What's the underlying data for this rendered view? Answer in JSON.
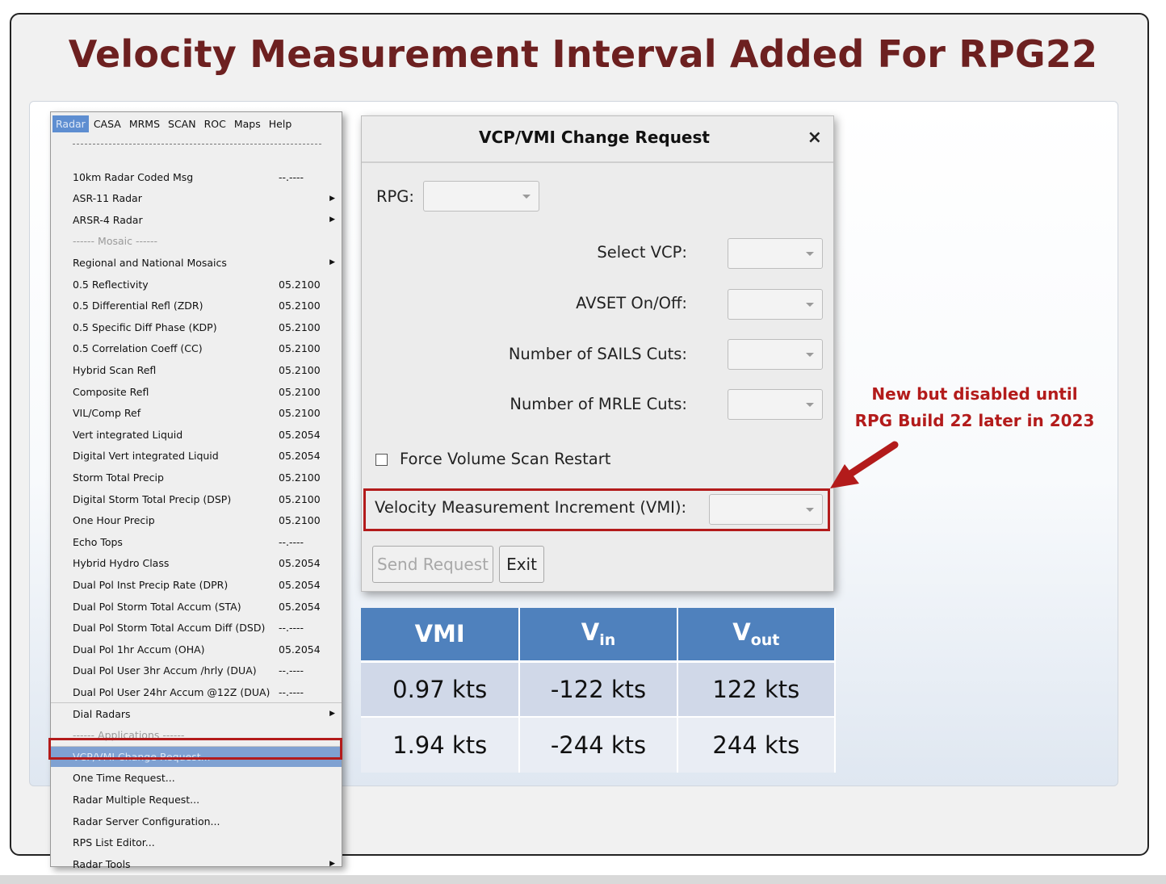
{
  "slide": {
    "title": "Velocity Measurement Interval Added For RPG22"
  },
  "menubar": {
    "items": [
      "Radar",
      "CASA",
      "MRMS",
      "SCAN",
      "ROC",
      "Maps",
      "Help"
    ],
    "active": "Radar"
  },
  "radar_menu": {
    "items": [
      {
        "label": "10km Radar Coded Msg",
        "version": "--.----"
      },
      {
        "label": "ASR-11 Radar",
        "submenu": true
      },
      {
        "label": "ARSR-4 Radar",
        "submenu": true
      },
      {
        "label": "------ Mosaic ------",
        "muted": true
      },
      {
        "label": "Regional and National Mosaics",
        "submenu": true
      },
      {
        "label": "0.5 Reflectivity",
        "version": "05.2100"
      },
      {
        "label": "0.5 Differential Refl (ZDR)",
        "version": "05.2100"
      },
      {
        "label": "0.5 Specific Diff Phase (KDP)",
        "version": "05.2100"
      },
      {
        "label": "0.5 Correlation Coeff (CC)",
        "version": "05.2100"
      },
      {
        "label": "Hybrid Scan Refl",
        "version": "05.2100"
      },
      {
        "label": "Composite Refl",
        "version": "05.2100"
      },
      {
        "label": "VIL/Comp Ref",
        "version": "05.2100"
      },
      {
        "label": "Vert integrated Liquid",
        "version": "05.2054"
      },
      {
        "label": "Digital Vert integrated Liquid",
        "version": "05.2054"
      },
      {
        "label": "Storm Total Precip",
        "version": "05.2100"
      },
      {
        "label": "Digital Storm Total Precip (DSP)",
        "version": "05.2100"
      },
      {
        "label": "One Hour Precip",
        "version": "05.2100"
      },
      {
        "label": "Echo Tops",
        "version": "--.----"
      },
      {
        "label": "Hybrid Hydro Class",
        "version": "05.2054"
      },
      {
        "label": "Dual Pol Inst Precip Rate (DPR)",
        "version": "05.2054"
      },
      {
        "label": "Dual Pol Storm Total Accum (STA)",
        "version": "05.2054"
      },
      {
        "label": "Dual Pol Storm Total Accum Diff (DSD)",
        "version": "--.----"
      },
      {
        "label": "Dual Pol 1hr Accum (OHA)",
        "version": "05.2054"
      },
      {
        "label": "Dual Pol User 3hr Accum /hrly (DUA)",
        "version": "--.----"
      },
      {
        "label": "Dual Pol User 24hr Accum @12Z (DUA)",
        "version": "--.----"
      },
      {
        "label": "Dial Radars",
        "submenu": true
      },
      {
        "label": "------ Applications ------",
        "muted": true
      },
      {
        "label": "VCP/VMI Change Request...",
        "highlight": true
      },
      {
        "label": "One Time Request..."
      },
      {
        "label": "Radar Multiple Request..."
      },
      {
        "label": "Radar Server Configuration..."
      },
      {
        "label": "RPS List Editor..."
      },
      {
        "label": "Radar Tools",
        "submenu": true
      }
    ]
  },
  "dialog": {
    "title": "VCP/VMI Change Request",
    "close_glyph": "×",
    "rpg_label": "RPG:",
    "select_vcp_label": "Select VCP:",
    "avset_label": "AVSET On/Off:",
    "sails_label": "Number of SAILS Cuts:",
    "mrle_label": "Number of MRLE Cuts:",
    "force_restart_label": "Force Volume Scan Restart",
    "force_restart_checked": false,
    "vmi_label": "Velocity Measurement Increment (VMI):",
    "send_button": "Send Request",
    "exit_button": "Exit"
  },
  "annotation": {
    "line1": "New but disabled until",
    "line2": "RPG Build 22 later in 2023",
    "color": "#b31b1b"
  },
  "vmi_table": {
    "headers": {
      "col1": "VMI",
      "col2_main": "V",
      "col2_sub": "in",
      "col3_main": "V",
      "col3_sub": "out"
    },
    "rows": [
      [
        "0.97 kts",
        "-122 kts",
        "122 kts"
      ],
      [
        "1.94 kts",
        "-244 kts",
        "244 kts"
      ]
    ],
    "header_color": "#4f81bd"
  },
  "colors": {
    "title": "#6d2020",
    "highlight_box": "#b31b1b",
    "menu_active": "#5e8ed1"
  }
}
